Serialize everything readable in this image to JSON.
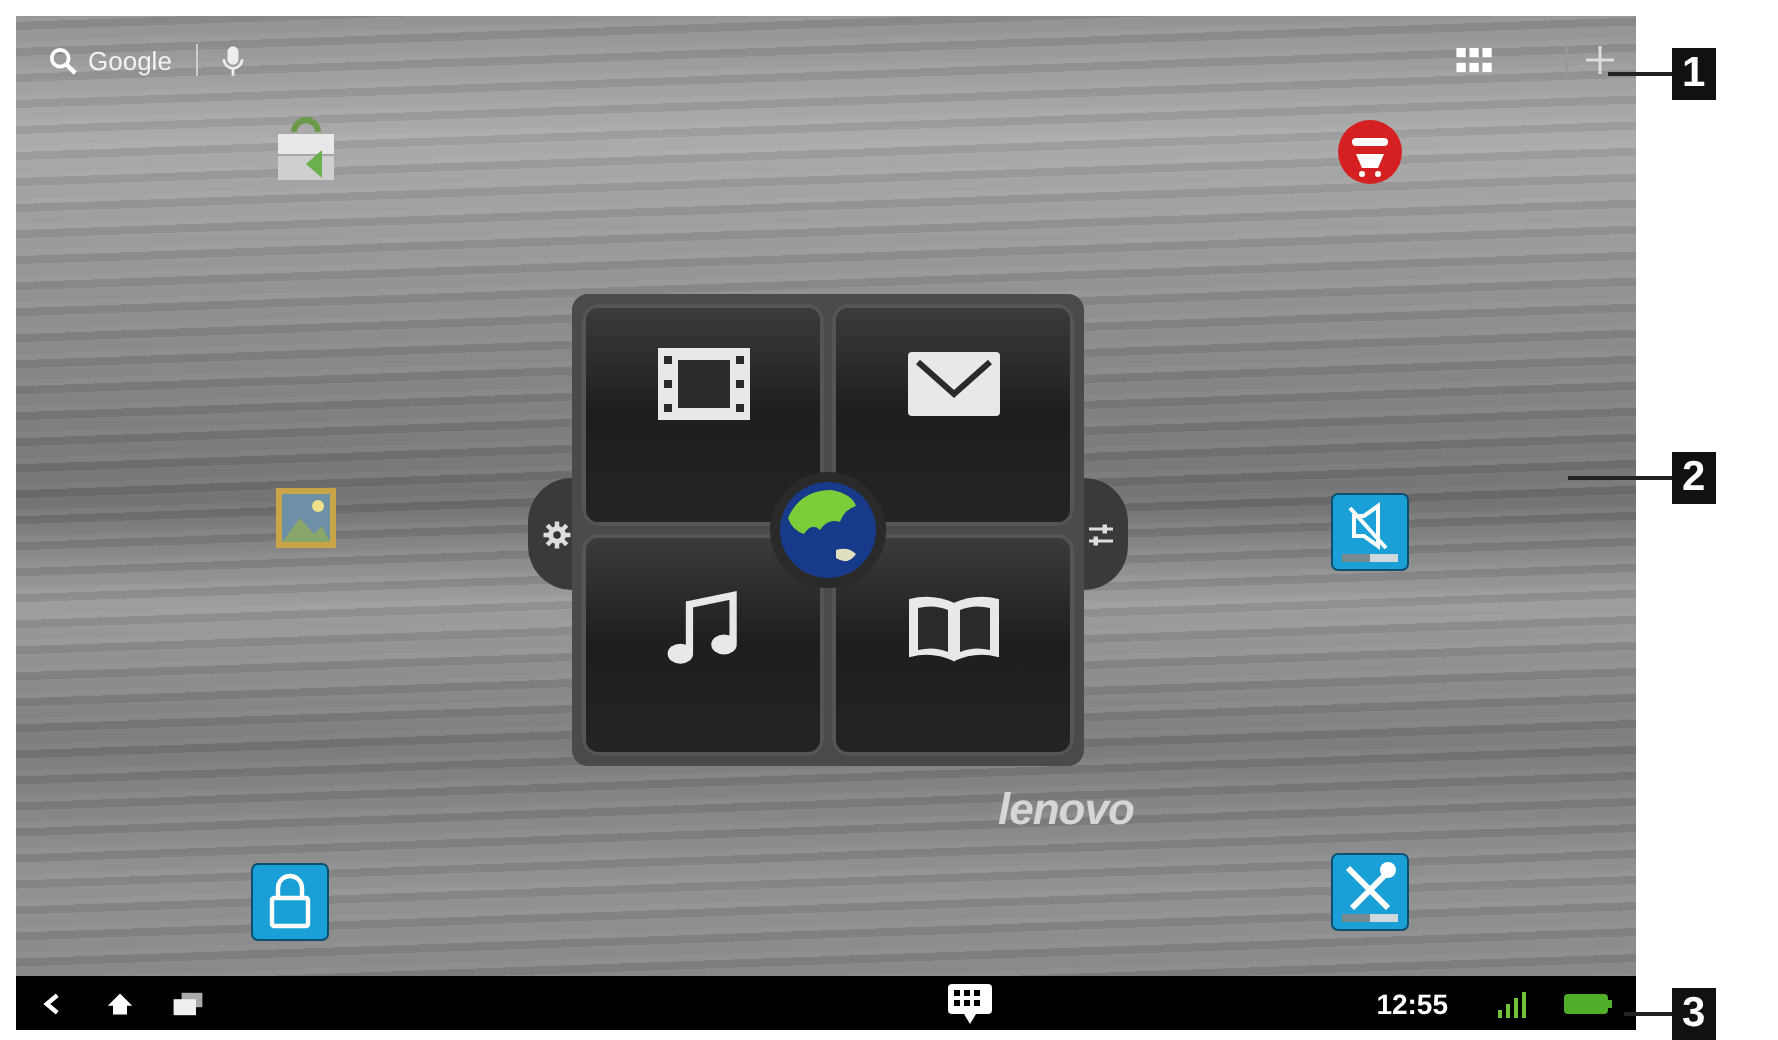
{
  "search": {
    "label": "Google"
  },
  "widget": {
    "logo": "lenovo"
  },
  "status_bar": {
    "time": "12:55"
  },
  "callouts": [
    "1",
    "2",
    "3"
  ]
}
